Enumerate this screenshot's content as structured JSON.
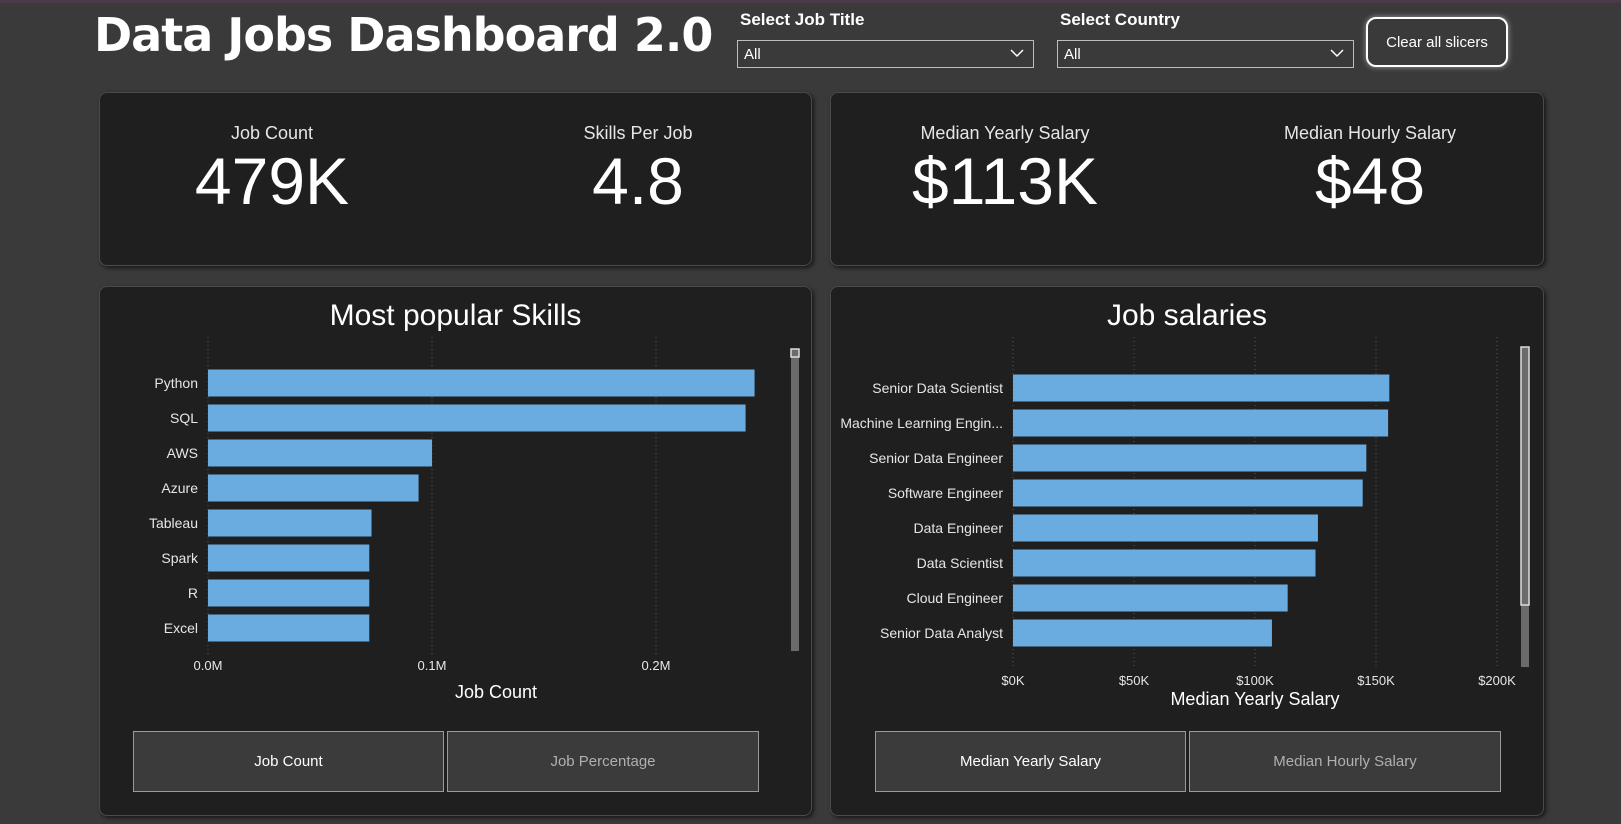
{
  "header": {
    "title": "Data Jobs Dashboard  2.0",
    "job_title_label": "Select Job Title",
    "job_title_value": "All",
    "country_label": "Select Country",
    "country_value": "All",
    "clear_label": "Clear all slicers"
  },
  "kpis": {
    "job_count_label": "Job Count",
    "job_count_value": "479K",
    "skills_per_job_label": "Skills Per Job",
    "skills_per_job_value": "4.8",
    "median_yearly_label": "Median Yearly Salary",
    "median_yearly_value": "$113K",
    "median_hourly_label": "Median Hourly Salary",
    "median_hourly_value": "$48"
  },
  "skills_panel": {
    "title": "Most popular Skills",
    "toggle_active": "Job Count",
    "toggle_inactive": "Job Percentage"
  },
  "salary_panel": {
    "title": "Job salaries",
    "toggle_active": "Median Yearly Salary",
    "toggle_inactive": "Median Hourly Salary"
  },
  "colors": {
    "bar": "#6aabe0",
    "card": "#1f1f1f",
    "background": "#3a3a3a"
  },
  "chart_data": [
    {
      "type": "bar",
      "orientation": "horizontal",
      "title": "Most popular Skills",
      "xlabel": "Job Count",
      "ylabel": "",
      "categories": [
        "Python",
        "SQL",
        "AWS",
        "Azure",
        "Tableau",
        "Spark",
        "R",
        "Excel"
      ],
      "values": [
        244000,
        240000,
        100000,
        94000,
        73000,
        72000,
        72000,
        72000
      ],
      "xlim": [
        0,
        250000
      ],
      "xticks": [
        0,
        100000,
        200000
      ],
      "xtick_labels": [
        "0.0M",
        "0.1M",
        "0.2M"
      ],
      "grid": "vertical-dotted"
    },
    {
      "type": "bar",
      "orientation": "horizontal",
      "title": "Job salaries",
      "xlabel": "Median Yearly Salary",
      "ylabel": "",
      "categories": [
        "Senior Data Scientist",
        "Machine Learning Engin...",
        "Senior Data Engineer",
        "Software Engineer",
        "Data Engineer",
        "Data Scientist",
        "Cloud Engineer",
        "Senior Data Analyst"
      ],
      "values": [
        155500,
        155000,
        146000,
        144500,
        126000,
        125000,
        113500,
        107000
      ],
      "xlim": [
        0,
        200000
      ],
      "xticks": [
        0,
        50000,
        100000,
        150000,
        200000
      ],
      "xtick_labels": [
        "$0K",
        "$50K",
        "$100K",
        "$150K",
        "$200K"
      ],
      "grid": "vertical-dotted"
    }
  ]
}
